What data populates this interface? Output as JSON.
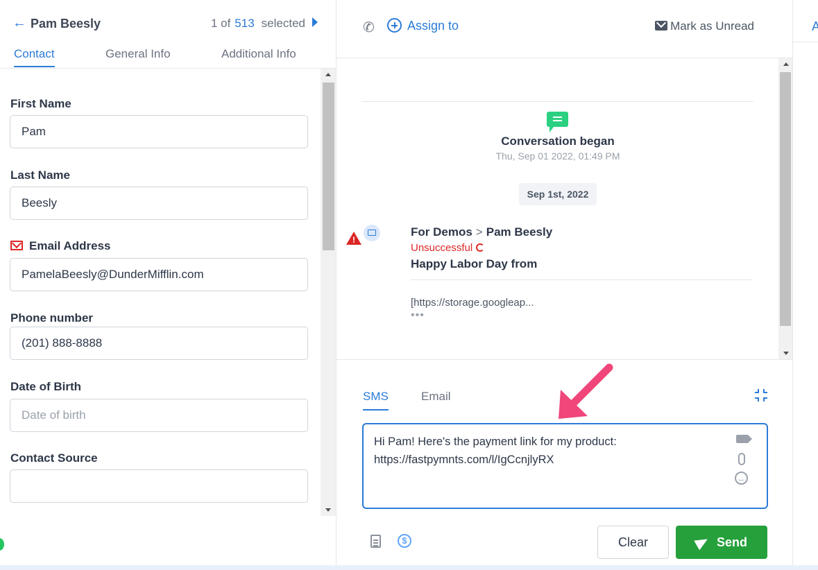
{
  "header": {
    "contact_name": "Pam Beesly",
    "pager_prefix": "1 of",
    "pager_count": "513",
    "pager_suffix": "selected"
  },
  "left_tabs": {
    "contact": "Contact",
    "general": "General Info",
    "additional": "Additional Info"
  },
  "form": {
    "first_name_label": "First Name",
    "first_name_value": "Pam",
    "last_name_label": "Last Name",
    "last_name_value": "Beesly",
    "email_label": "Email Address",
    "email_value": "PamelaBeesly@DunderMifflin.com",
    "phone_label": "Phone number",
    "phone_value": "(201) 888-8888",
    "dob_label": "Date of Birth",
    "dob_placeholder": "Date of birth",
    "source_label": "Contact Source",
    "source_value": ""
  },
  "mid_header": {
    "assign_label": "Assign to",
    "mark_unread_label": "Mark as Unread"
  },
  "conversation": {
    "began_title": "Conversation began",
    "began_time": "Thu, Sep 01 2022, 01:49 PM",
    "date_chip": "Sep 1st, 2022",
    "message": {
      "from": "For Demos",
      "separator": ">",
      "to": "Pam Beesly",
      "status": "Unsuccessful",
      "subject": "Happy Labor Day from",
      "preview": "[https://storage.googleap...",
      "more": "•••"
    }
  },
  "composer": {
    "tab_sms": "SMS",
    "tab_email": "Email",
    "message_line1": "Hi Pam! Here's the payment link for my product:",
    "message_line2": "https://fastpymnts.com/l/IgCcnjlyRX",
    "clear_label": "Clear",
    "send_label": "Send"
  },
  "right_panel": {
    "tab_initial": "A"
  },
  "colors": {
    "accent": "#2b7bd8",
    "send_green": "#25a03a",
    "error_red": "#dc2626",
    "chat_green": "#2bd180",
    "annotation_pink": "#f0467a"
  }
}
